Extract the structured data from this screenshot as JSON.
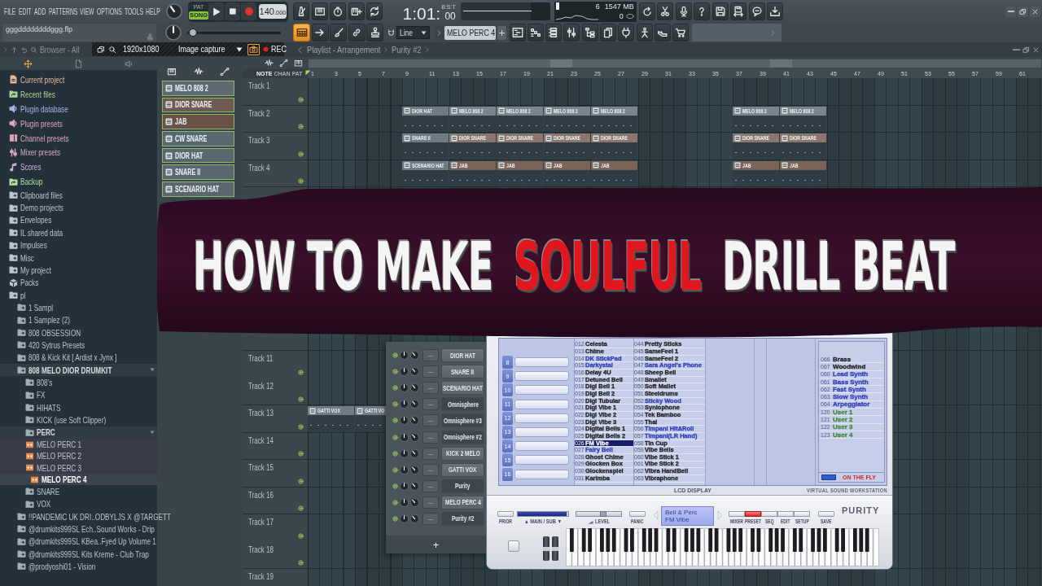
{
  "menu": [
    "FILE",
    "EDIT",
    "ADD",
    "PATTERNS",
    "VIEW",
    "OPTIONS",
    "TOOLS",
    "HELP"
  ],
  "transport": {
    "modes": [
      {
        "label": "PAT",
        "selected": false
      },
      {
        "label": "SONG",
        "selected": true
      }
    ],
    "tempo": {
      "whole": "140",
      "fraction": ".000"
    }
  },
  "time": {
    "main": "1:01:",
    "label": "B:S:T",
    "sub": "00"
  },
  "monitor": {
    "cpu": "6",
    "memory": "1547 MB",
    "polyphony": "0"
  },
  "file_name": "gggddddddddggg.flp",
  "master_pitch": {
    "level": 0.02
  },
  "tools": [
    {
      "selected": true
    },
    {
      "selected": false
    },
    {
      "selected": false
    },
    {
      "selected": false
    },
    {
      "selected": false
    }
  ],
  "snap": "Line",
  "pattern": "MELO PERC 4",
  "capture_toolbar": {
    "resolution": "1920x1080",
    "mode": "Image capture",
    "record": "REC"
  },
  "browser": {
    "title": "Browser - All",
    "items": [
      {
        "label": "Current project",
        "kind": "project",
        "color": "#e8b89c"
      },
      {
        "label": "Recent files",
        "kind": "recent",
        "color": "#a6d69a"
      },
      {
        "label": "Plugin database",
        "kind": "plugin",
        "color": "#a1b8e6"
      },
      {
        "label": "Plugin presets",
        "kind": "plugin",
        "color": "#e0a3c7"
      },
      {
        "label": "Channel presets",
        "kind": "channel",
        "color": "#dca6b5"
      },
      {
        "label": "Mixer presets",
        "kind": "mixer",
        "color": "#d8a8c2"
      },
      {
        "label": "Scores",
        "kind": "score",
        "color": "#cdb6d8"
      },
      {
        "label": "Backup",
        "kind": "recent",
        "color": "#b3e0a0"
      },
      {
        "label": "Clipboard files",
        "kind": "folder",
        "color": "#b9c6ce"
      },
      {
        "label": "Demo projects",
        "kind": "folder",
        "color": "#b9c6ce"
      },
      {
        "label": "Envelopes",
        "kind": "folder",
        "color": "#b9c6ce"
      },
      {
        "label": "IL shared data",
        "kind": "folder",
        "color": "#b9c6ce"
      },
      {
        "label": "Impulses",
        "kind": "folder",
        "color": "#b9c6ce"
      },
      {
        "label": "Misc",
        "kind": "folder",
        "color": "#b9c6ce"
      },
      {
        "label": "My project",
        "kind": "folder",
        "color": "#b9c6ce"
      },
      {
        "label": "Packs",
        "kind": "pack",
        "color": "#b9c6ce"
      },
      {
        "label": "pl",
        "kind": "folder",
        "color": "#b9c6ce",
        "children": [
          {
            "label": "1 Sampl",
            "kind": "folder",
            "expanded": false
          },
          {
            "label": "1 Samplez (2)",
            "kind": "folder",
            "expanded": false
          },
          {
            "label": "808 OBSESSION",
            "kind": "folder",
            "expanded": false
          },
          {
            "label": "420 Sytrus Presets",
            "kind": "folder",
            "expanded": false
          },
          {
            "label": "808 & Kick Kit [ Ardist x Jynx ]",
            "kind": "folder",
            "expanded": false
          },
          {
            "label": "808 MELO DIOR DRUMKIT",
            "kind": "folder",
            "expanded": true,
            "children": [
              {
                "label": "808's",
                "kind": "folder",
                "expanded": false
              },
              {
                "label": "FX",
                "kind": "folder",
                "expanded": false
              },
              {
                "label": "HIHATS",
                "kind": "folder",
                "expanded": false
              },
              {
                "label": "KICK (use Soft Clipper)",
                "kind": "folder",
                "expanded": false
              },
              {
                "label": "PERC",
                "kind": "folder",
                "expanded": true,
                "children": [
                  {
                    "label": "MELO PERC 1",
                    "kind": "audio",
                    "selected": false
                  },
                  {
                    "label": "MELO PERC 2",
                    "kind": "audio",
                    "selected": false
                  },
                  {
                    "label": "MELO PERC 3",
                    "kind": "audio",
                    "selected": false
                  },
                  {
                    "label": "MELO PERC 4",
                    "kind": "audio",
                    "selected": true
                  }
                ]
              },
              {
                "label": "SNARE",
                "kind": "folder",
                "expanded": false
              },
              {
                "label": "VOX",
                "kind": "folder",
                "expanded": false
              }
            ]
          },
          {
            "label": "!!PANDEMIC UK DRI..ODBYLJS X @TARGETT",
            "kind": "folder",
            "expanded": false
          },
          {
            "label": "@drumkits999SL Ech..Sound Works - Drip",
            "kind": "folder",
            "expanded": false
          },
          {
            "label": "@drumkits999SL KBea..Fyed Up Volume 1",
            "kind": "folder",
            "expanded": false
          },
          {
            "label": "@drumkits999SL Kits Kreme - Club Trap",
            "kind": "folder",
            "expanded": false
          },
          {
            "label": "@prodyoshi01 - Vision",
            "kind": "folder",
            "expanded": false
          }
        ]
      }
    ]
  },
  "patterns": [
    {
      "label": "MELO 808 2",
      "color": "#5d6a73"
    },
    {
      "label": "DIOR SNARE",
      "color": "#6e5c52"
    },
    {
      "label": "JAB",
      "color": "#6a5247"
    },
    {
      "label": "CW SNARE",
      "color": "#586872"
    },
    {
      "label": "DIOR HAT",
      "color": "#586872"
    },
    {
      "label": "SNARE II",
      "color": "#5a6770"
    },
    {
      "label": "SCENARIO HAT",
      "color": "#5a6770"
    }
  ],
  "playlist": {
    "title": "Playlist - Arrangement",
    "breadcrumb": "Purity #2",
    "modes": [
      {
        "label": "NOTE",
        "selected": true
      },
      {
        "label": "CHAN",
        "selected": false
      },
      {
        "label": "PAT",
        "selected": false
      }
    ],
    "ruler": [
      "1",
      "3",
      "5",
      "7",
      "9",
      "11",
      "13",
      "15",
      "17",
      "19",
      "21",
      "23",
      "25",
      "27",
      "29",
      "31",
      "33",
      "35",
      "37",
      "39",
      "41",
      "43",
      "45",
      "47",
      "49",
      "51",
      "53",
      "55",
      "57",
      "59",
      "61"
    ],
    "tracks_upper": [
      {
        "name": "Track 1"
      },
      {
        "name": "Track 2",
        "lane": [
          {
            "kind": "gap"
          },
          {
            "kind": "gap"
          },
          {
            "kind": "clip",
            "label": "DIOR HAT",
            "color": "#6e7b84"
          },
          {
            "kind": "clip",
            "label": "MELO 808 2",
            "color": "#788690"
          },
          {
            "kind": "clip",
            "label": "MELO 808 2",
            "color": "#788690"
          },
          {
            "kind": "clip",
            "label": "MELO 808 2",
            "color": "#788690"
          },
          {
            "kind": "clip",
            "label": "MELO 808 2",
            "color": "#788690"
          },
          {
            "kind": "gap"
          },
          {
            "kind": "gap"
          },
          {
            "kind": "clip",
            "label": "MELO 808 2",
            "color": "#788690"
          },
          {
            "kind": "clip",
            "label": "MELO 808 2",
            "color": "#788690"
          }
        ]
      },
      {
        "name": "Track 3",
        "lane": [
          {
            "kind": "gap"
          },
          {
            "kind": "gap"
          },
          {
            "kind": "clip",
            "label": "SNARE II",
            "color": "#6e7b84"
          },
          {
            "kind": "clip",
            "label": "DIOR SNARE",
            "color": "#8a766c"
          },
          {
            "kind": "clip",
            "label": "DIOR SNARE",
            "color": "#8a766c"
          },
          {
            "kind": "clip",
            "label": "DIOR SNARE",
            "color": "#8a766c"
          },
          {
            "kind": "clip",
            "label": "DIOR SNARE",
            "color": "#8a766c"
          },
          {
            "kind": "gap"
          },
          {
            "kind": "gap"
          },
          {
            "kind": "clip",
            "label": "DIOR SNARE",
            "color": "#8a766c"
          },
          {
            "kind": "clip",
            "label": "DIOR SNARE",
            "color": "#8a766c"
          }
        ]
      },
      {
        "name": "Track 4",
        "lane": [
          {
            "kind": "gap"
          },
          {
            "kind": "gap"
          },
          {
            "kind": "clip",
            "label": "SCENARIO HAT",
            "color": "#6e7b84"
          },
          {
            "kind": "clip",
            "label": "JAB",
            "color": "#7b6358"
          },
          {
            "kind": "clip",
            "label": "JAB",
            "color": "#7b6358"
          },
          {
            "kind": "clip",
            "label": "JAB",
            "color": "#7b6358"
          },
          {
            "kind": "clip",
            "label": "JAB",
            "color": "#7b6358"
          },
          {
            "kind": "gap"
          },
          {
            "kind": "gap"
          },
          {
            "kind": "clip",
            "label": "JAB",
            "color": "#7b6358"
          },
          {
            "kind": "clip",
            "label": "JAB",
            "color": "#7b6358"
          }
        ]
      }
    ],
    "tracks_lower": [
      {
        "name": "Track 11"
      },
      {
        "name": "Track 12"
      },
      {
        "name": "Track 13",
        "lane": [
          {
            "kind": "clip",
            "label": "GATTI VOX",
            "color": "#6f7d87"
          },
          {
            "kind": "clip",
            "label": "GATTI VO",
            "color": "#6f7d87"
          }
        ]
      },
      {
        "name": "Track 14"
      },
      {
        "name": "Track 15"
      },
      {
        "name": "Track 16"
      },
      {
        "name": "Track 17"
      },
      {
        "name": "Track 18"
      },
      {
        "name": "Track 19"
      }
    ]
  },
  "channel_rack": {
    "channels": [
      {
        "name": "DIOR HAT",
        "mixer": "---",
        "kind": "sample"
      },
      {
        "name": "SNARE II",
        "mixer": "---",
        "kind": "sample"
      },
      {
        "name": "SCENARIO HAT",
        "mixer": "---",
        "kind": "sample"
      },
      {
        "name": "Omnisphere",
        "mixer": "---",
        "kind": "plugin"
      },
      {
        "name": "Omnisphere #3",
        "mixer": "---",
        "kind": "plugin"
      },
      {
        "name": "Omnisphere #2",
        "mixer": "---",
        "kind": "plugin"
      },
      {
        "name": "KICK 2 MELO",
        "mixer": "---",
        "kind": "sample"
      },
      {
        "name": "GATTI VOX",
        "mixer": "---",
        "kind": "sample"
      },
      {
        "name": "Purity",
        "mixer": "---",
        "kind": "plugin"
      },
      {
        "name": "MELO PERC 4",
        "mixer": "---",
        "kind": "sample"
      },
      {
        "name": "Purity #2",
        "mixer": "---",
        "kind": "plugin"
      }
    ],
    "add": "+"
  },
  "purity": {
    "parts": [
      "8",
      "9",
      "10",
      "11",
      "12",
      "13",
      "14",
      "15",
      "16"
    ],
    "preset_columns": [
      [
        {
          "number": "012",
          "name": "Celesta",
          "color": "#1e1e1e",
          "selected": false
        },
        {
          "number": "013",
          "name": "Chime",
          "color": "#1e1e1e",
          "selected": false
        },
        {
          "number": "014",
          "name": "DK StickPad",
          "color": "#2b3db5",
          "selected": false
        },
        {
          "number": "015",
          "name": "Darkystal",
          "color": "#2b3db5",
          "selected": false
        },
        {
          "number": "016",
          "name": "Delay 4U",
          "color": "#1e1e1e",
          "selected": false
        },
        {
          "number": "017",
          "name": "Detuned Bell",
          "color": "#1e1e1e",
          "selected": false
        },
        {
          "number": "018",
          "name": "Digi Bell 1",
          "color": "#1e1e1e",
          "selected": false
        },
        {
          "number": "019",
          "name": "Digi Bell 2",
          "color": "#1e1e1e",
          "selected": false
        },
        {
          "number": "020",
          "name": "Digi Tubular",
          "color": "#1e1e1e",
          "selected": false
        },
        {
          "number": "021",
          "name": "Digi Vibe 1",
          "color": "#1e1e1e",
          "selected": false
        },
        {
          "number": "022",
          "name": "Digi Vibe 2",
          "color": "#1e1e1e",
          "selected": false
        },
        {
          "number": "023",
          "name": "Digi Vibe 3",
          "color": "#1e1e1e",
          "selected": false
        },
        {
          "number": "024",
          "name": "Digital Bells 1",
          "color": "#1e1e1e",
          "selected": false
        },
        {
          "number": "025",
          "name": "Digital Bells 2",
          "color": "#1e1e1e",
          "selected": false
        },
        {
          "number": "026",
          "name": "FM Vibe",
          "selected": true
        },
        {
          "number": "027",
          "name": "Fairy Bell",
          "color": "#2b3db5",
          "selected": false
        },
        {
          "number": "028",
          "name": "Ghost Chime",
          "color": "#1e1e1e",
          "selected": false
        },
        {
          "number": "029",
          "name": "Glocken Box",
          "color": "#1e1e1e",
          "selected": false
        },
        {
          "number": "030",
          "name": "Glockenspiel",
          "color": "#1e1e1e",
          "selected": false
        },
        {
          "number": "031",
          "name": "Karimba",
          "color": "#1e1e1e",
          "selected": false
        }
      ],
      [
        {
          "number": "044",
          "name": "Pretty Sticks",
          "color": "#1e1e1e",
          "selected": false
        },
        {
          "number": "045",
          "name": "SameFeel 1",
          "color": "#1e1e1e",
          "selected": false
        },
        {
          "number": "046",
          "name": "SameFeel 2",
          "color": "#1e1e1e",
          "selected": false
        },
        {
          "number": "047",
          "name": "Sara Angel's Phone",
          "color": "#2b3db5",
          "selected": false
        },
        {
          "number": "048",
          "name": "Sheep Bell",
          "color": "#1e1e1e",
          "selected": false
        },
        {
          "number": "049",
          "name": "Smallet",
          "color": "#1e1e1e",
          "selected": false
        },
        {
          "number": "050",
          "name": "Soft Mallet",
          "color": "#1e1e1e",
          "selected": false
        },
        {
          "number": "051",
          "name": "Steeldrums",
          "color": "#1e1e1e",
          "selected": false
        },
        {
          "number": "052",
          "name": "Sticky Wood",
          "color": "#2b3db5",
          "selected": false
        },
        {
          "number": "053",
          "name": "Synlophone",
          "color": "#1e1e1e",
          "selected": false
        },
        {
          "number": "054",
          "name": "Tek Bamboo",
          "color": "#1e1e1e",
          "selected": false
        },
        {
          "number": "055",
          "name": "Thai",
          "color": "#1e1e1e",
          "selected": false
        },
        {
          "number": "056",
          "name": "Timpani Hit&Roll",
          "color": "#2b3db5",
          "selected": false
        },
        {
          "number": "057",
          "name": "Timpani(LR Hand)",
          "color": "#2b3db5",
          "selected": false
        },
        {
          "number": "058",
          "name": "Tin Cup",
          "color": "#1e1e1e",
          "selected": false
        },
        {
          "number": "059",
          "name": "Vibe Bells",
          "color": "#1e1e1e",
          "selected": false
        },
        {
          "number": "060",
          "name": "Vibe Stick 1",
          "color": "#1e1e1e",
          "selected": false
        },
        {
          "number": "061",
          "name": "Vibe Stick 2",
          "color": "#1e1e1e",
          "selected": false
        },
        {
          "number": "062",
          "name": "Vibra HandBell",
          "color": "#1e1e1e",
          "selected": false
        },
        {
          "number": "063",
          "name": "Vibraphone",
          "color": "#1e1e1e",
          "selected": false
        }
      ]
    ],
    "categories": [
      {
        "number": "066",
        "name": "Brass",
        "color": "#1e1e1e"
      },
      {
        "number": "067",
        "name": "Woodwind",
        "color": "#1e1e1e"
      },
      {
        "number": "060",
        "name": "Lead Synth",
        "color": "#2b3db5"
      },
      {
        "number": "061",
        "name": "Bass Synth",
        "color": "#2b3db5"
      },
      {
        "number": "062",
        "name": "Fast Synth",
        "color": "#2b3db5"
      },
      {
        "number": "063",
        "name": "Slow Synth",
        "color": "#2b3db5"
      },
      {
        "number": "064",
        "name": "Arpeggiator",
        "color": "#2b3db5"
      },
      {
        "number": "120",
        "name": "User 1",
        "color": "#3a8a3a"
      },
      {
        "number": "121",
        "name": "User 2",
        "color": "#3a8a3a"
      },
      {
        "number": "122",
        "name": "User 3",
        "color": "#3a8a3a"
      },
      {
        "number": "123",
        "name": "User 4",
        "color": "#3a8a3a"
      }
    ],
    "on_the_fly": {
      "label": "ON THE FLY",
      "on": true
    },
    "lcd_label": "LCD DISPLAY",
    "tagline": "VIRTUAL SOUND WORKSTATION",
    "prior": "PRIOR",
    "main_sub": {
      "label": "▲ MAIN / SUB ▼",
      "level": 0.97
    },
    "level_slider": {
      "label": "LEVEL",
      "level": 0.62
    },
    "panic": "PANIC",
    "display": {
      "category": "Bell & Perc",
      "preset": "FM Vibe"
    },
    "modes": [
      {
        "label": "MIXER",
        "selected": false
      },
      {
        "label": "PRESET",
        "selected": true
      },
      {
        "label": "SEQ",
        "selected": false
      },
      {
        "label": "EDIT",
        "selected": false
      },
      {
        "label": "SETUP",
        "selected": false
      }
    ],
    "save": "SAVE",
    "logo": "PURITY"
  },
  "headline": {
    "parts": [
      {
        "text": "HOW TO MAKE",
        "highlight": false
      },
      {
        "text": "SOULFUL",
        "highlight": true
      },
      {
        "text": "DRILL BEAT",
        "highlight": false
      }
    ]
  }
}
